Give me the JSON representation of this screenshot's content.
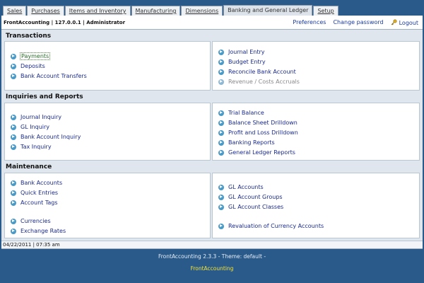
{
  "tabs": [
    {
      "label": "Sales",
      "active": false
    },
    {
      "label": "Purchases",
      "active": false
    },
    {
      "label": "Items and Inventory",
      "active": false
    },
    {
      "label": "Manufacturing",
      "active": false
    },
    {
      "label": "Dimensions",
      "active": false
    },
    {
      "label": "Banking and General Ledger",
      "active": true
    },
    {
      "label": "Setup",
      "active": false
    }
  ],
  "header": {
    "title": "FrontAccounting | 127.0.0.1 | Administrator",
    "preferences": "Preferences",
    "change_password": "Change password",
    "logout": "Logout"
  },
  "transactions": {
    "title": "Transactions",
    "left": [
      "Payments",
      "Deposits",
      "Bank Account Transfers"
    ],
    "right": [
      "Journal Entry",
      "Budget Entry",
      "Reconcile Bank Account",
      "Revenue / Costs Accruals"
    ]
  },
  "inquiries": {
    "title": "Inquiries and Reports",
    "left": [
      "Journal Inquiry",
      "GL Inquiry",
      "Bank Account Inquiry",
      "Tax Inquiry"
    ],
    "right": [
      "Trial Balance",
      "Balance Sheet Drilldown",
      "Profit and Loss Drilldown",
      "Banking Reports",
      "General Ledger Reports"
    ]
  },
  "maintenance": {
    "title": "Maintenance",
    "left": [
      "Bank Accounts",
      "Quick Entries",
      "Account Tags",
      "Currencies",
      "Exchange Rates"
    ],
    "right": [
      "GL Accounts",
      "GL Account Groups",
      "GL Account Classes",
      "Revaluation of Currency Accounts"
    ]
  },
  "status": "04/22/2011 | 07:35 am",
  "footer": {
    "version": "FrontAccounting 2.3.3 - Theme: default -",
    "link": "FrontAccounting"
  },
  "colors": {
    "background": "#2a5a8a",
    "panel": "#ffffff",
    "link": "#1a2a8a",
    "footer_link": "#f3e23a"
  }
}
